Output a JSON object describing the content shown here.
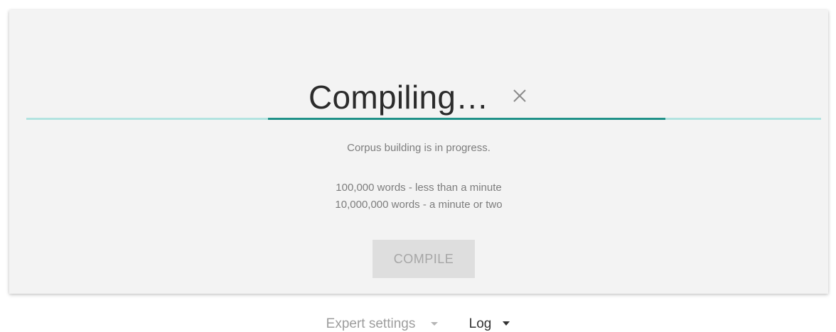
{
  "dialog": {
    "title": "Compiling…",
    "close_icon": "close-icon",
    "progress": 0.5,
    "status_text": "Corpus building is in progress.",
    "time_estimates": [
      "100,000 words - less than a minute",
      "10,000,000 words - a minute or two"
    ],
    "compile_button_label": "COMPILE"
  },
  "footer": {
    "expert_settings_label": "Expert settings",
    "log_label": "Log",
    "dropdown_icon": "caret-down-icon"
  },
  "colors": {
    "progress_track": "#b2e3e0",
    "progress_fill": "#1f9188",
    "panel_background": "#f3f3f3"
  }
}
